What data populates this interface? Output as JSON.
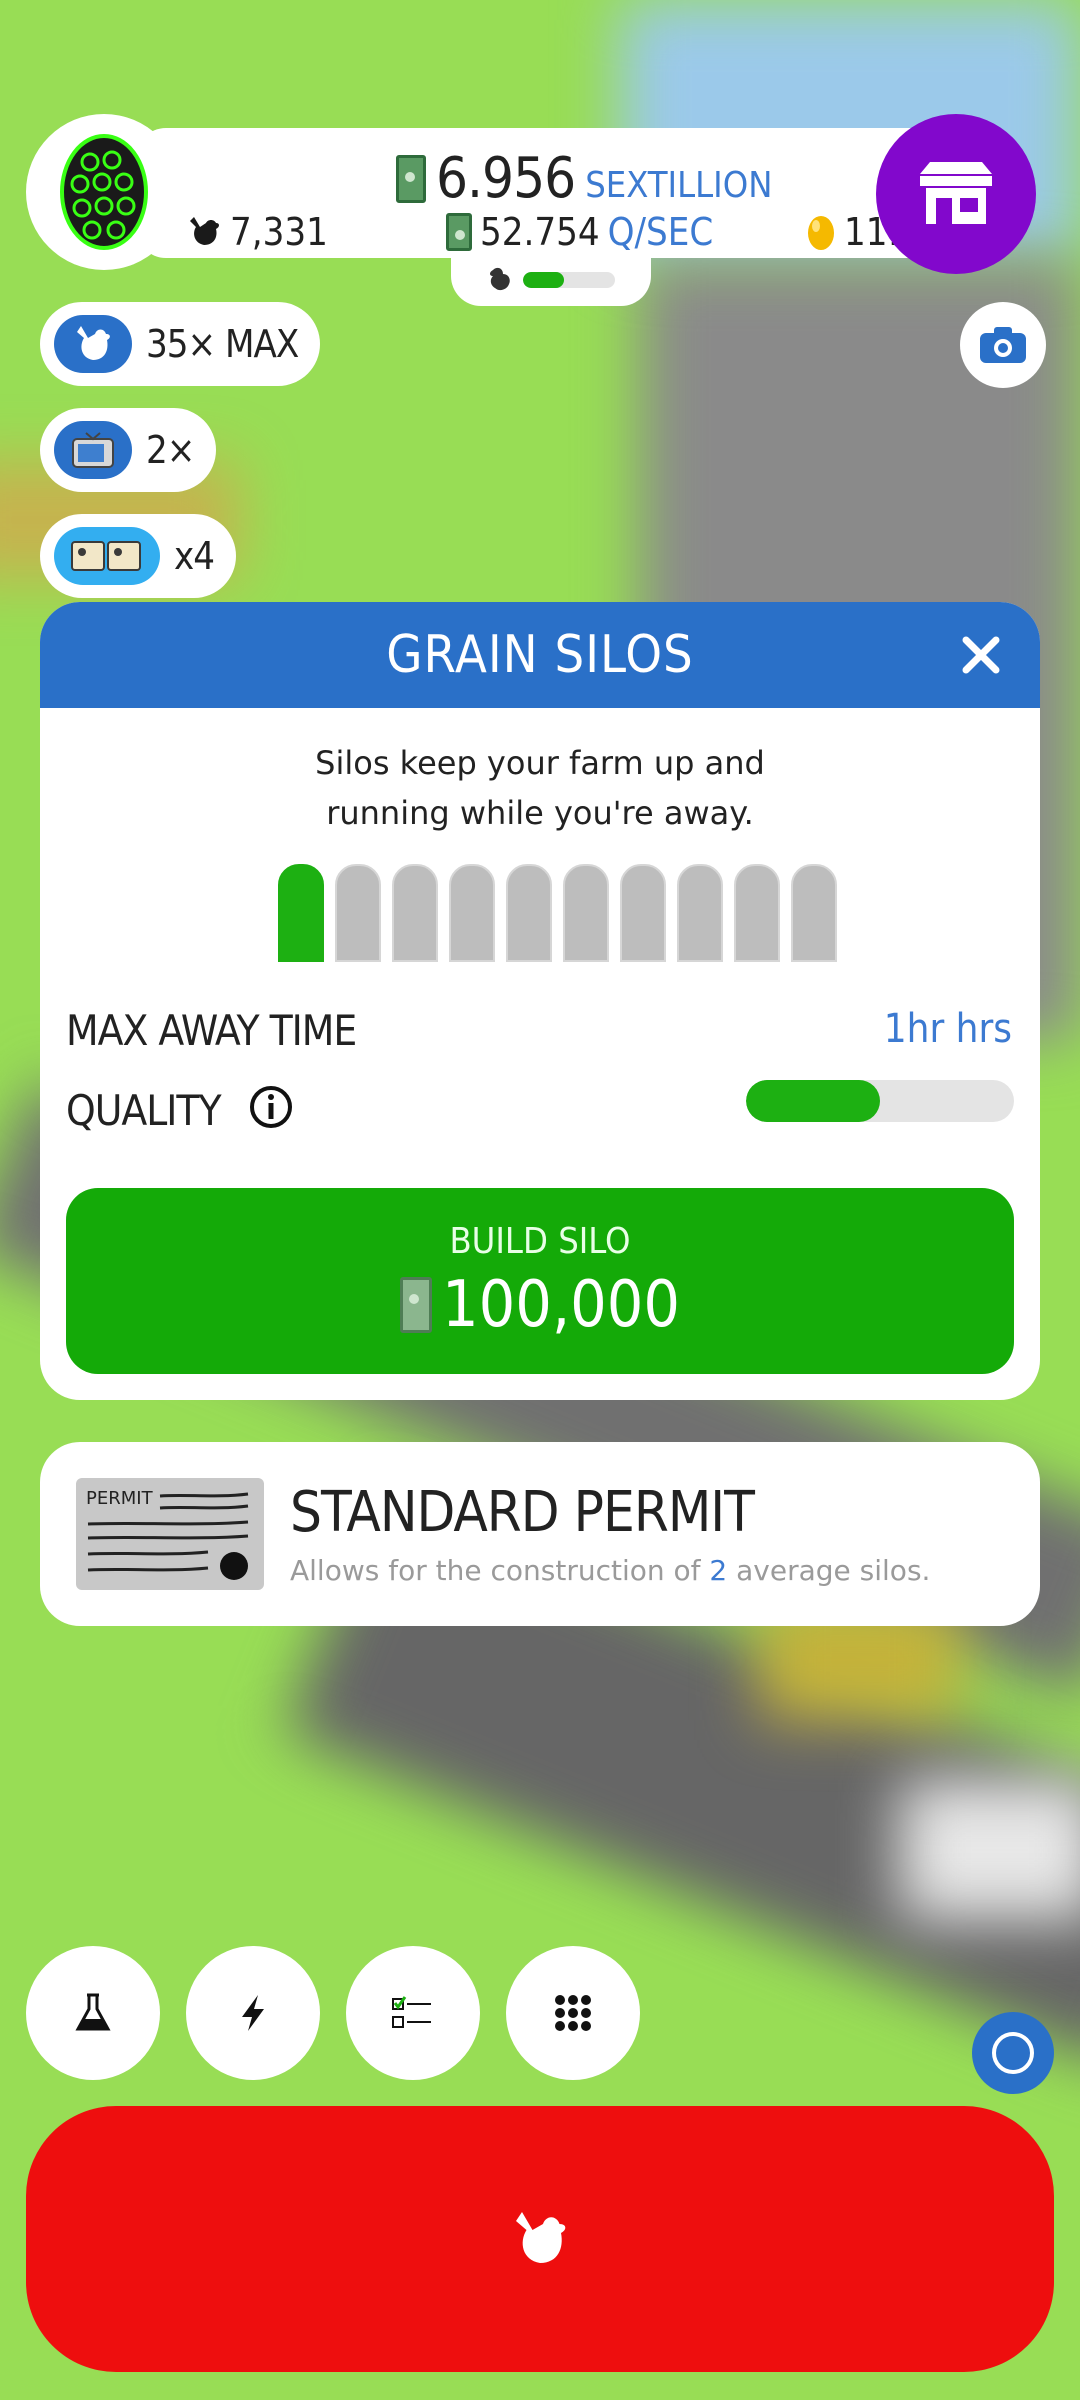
{
  "hud": {
    "money_value": "6.956",
    "money_unit": "SEXTILLION",
    "chickens": "7,331",
    "rate_value": "52.754",
    "rate_unit": "Q/SEC",
    "golden_eggs": "111",
    "habitat_progress_fraction": 0.45
  },
  "boosts": [
    {
      "label": "35× MAX",
      "icon": "chicken-icon"
    },
    {
      "label": "2×",
      "icon": "tv-icon"
    },
    {
      "label": "x4",
      "icon": "boost-cards-icon"
    }
  ],
  "dialog": {
    "title": "GRAIN SILOS",
    "description": "Silos keep your farm up and running while you're away.",
    "silos_total": 10,
    "silos_built": 1,
    "max_away_label": "MAX AWAY TIME",
    "max_away_value": "1hr hrs",
    "quality_label": "QUALITY",
    "quality_fraction": 0.5,
    "build_label": "BUILD SILO",
    "build_price": "100,000"
  },
  "permit": {
    "image_text": "PERMIT",
    "title": "STANDARD PERMIT",
    "desc_prefix": "Allows for the construction of ",
    "desc_number": "2",
    "desc_suffix": " average silos."
  },
  "colors": {
    "header_blue": "#2a70c8",
    "build_green": "#14aa08",
    "shop_purple": "#8208cc",
    "hatch_red": "#ee0e0e",
    "accent_blue": "#3c7ad1"
  }
}
